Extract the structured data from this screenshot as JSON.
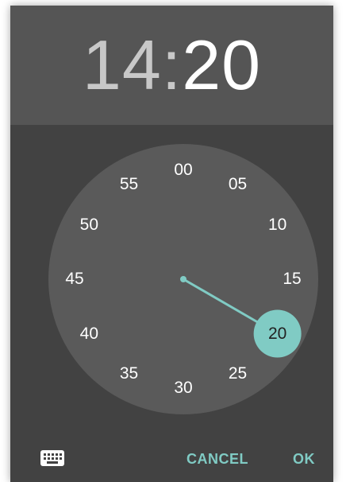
{
  "time": {
    "hour": "14",
    "separator": ":",
    "minute": "20"
  },
  "clock": {
    "selected_minute": "20",
    "minutes": [
      "00",
      "05",
      "10",
      "15",
      "20",
      "25",
      "30",
      "35",
      "40",
      "45",
      "50",
      "55"
    ]
  },
  "actions": {
    "cancel_label": "CANCEL",
    "ok_label": "OK"
  },
  "icons": {
    "keyboard": "keyboard-icon"
  },
  "colors": {
    "accent": "#80cbc4",
    "header_bg": "#555555",
    "dialog_bg": "#424242",
    "dial_bg": "#5a5a5a"
  }
}
